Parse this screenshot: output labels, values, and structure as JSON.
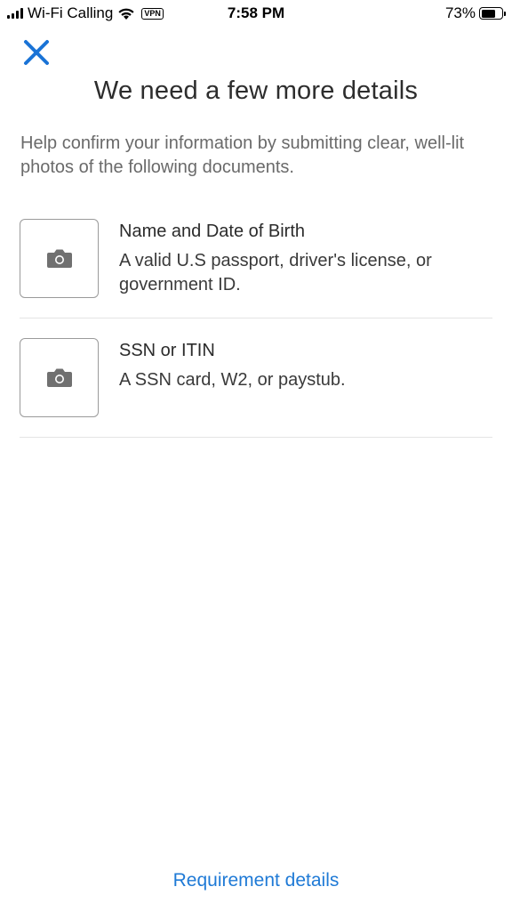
{
  "status_bar": {
    "carrier": "Wi-Fi Calling",
    "vpn": "VPN",
    "time": "7:58 PM",
    "battery": "73%",
    "battery_level": 0.73
  },
  "header": {
    "close_icon": "close-icon",
    "title": "We need a few more details"
  },
  "intro": "Help confirm your information by submitting clear, well-lit photos of the following documents.",
  "documents": [
    {
      "icon": "camera-icon",
      "title": "Name and Date of Birth",
      "description": "A valid U.S passport, driver's license, or government ID."
    },
    {
      "icon": "camera-icon",
      "title": "SSN or ITIN",
      "description": "A SSN card, W2, or paystub."
    }
  ],
  "footer": {
    "link": "Requirement details"
  },
  "colors": {
    "accent": "#1f7ad6",
    "close": "#1a73d6",
    "camera": "#707070"
  }
}
